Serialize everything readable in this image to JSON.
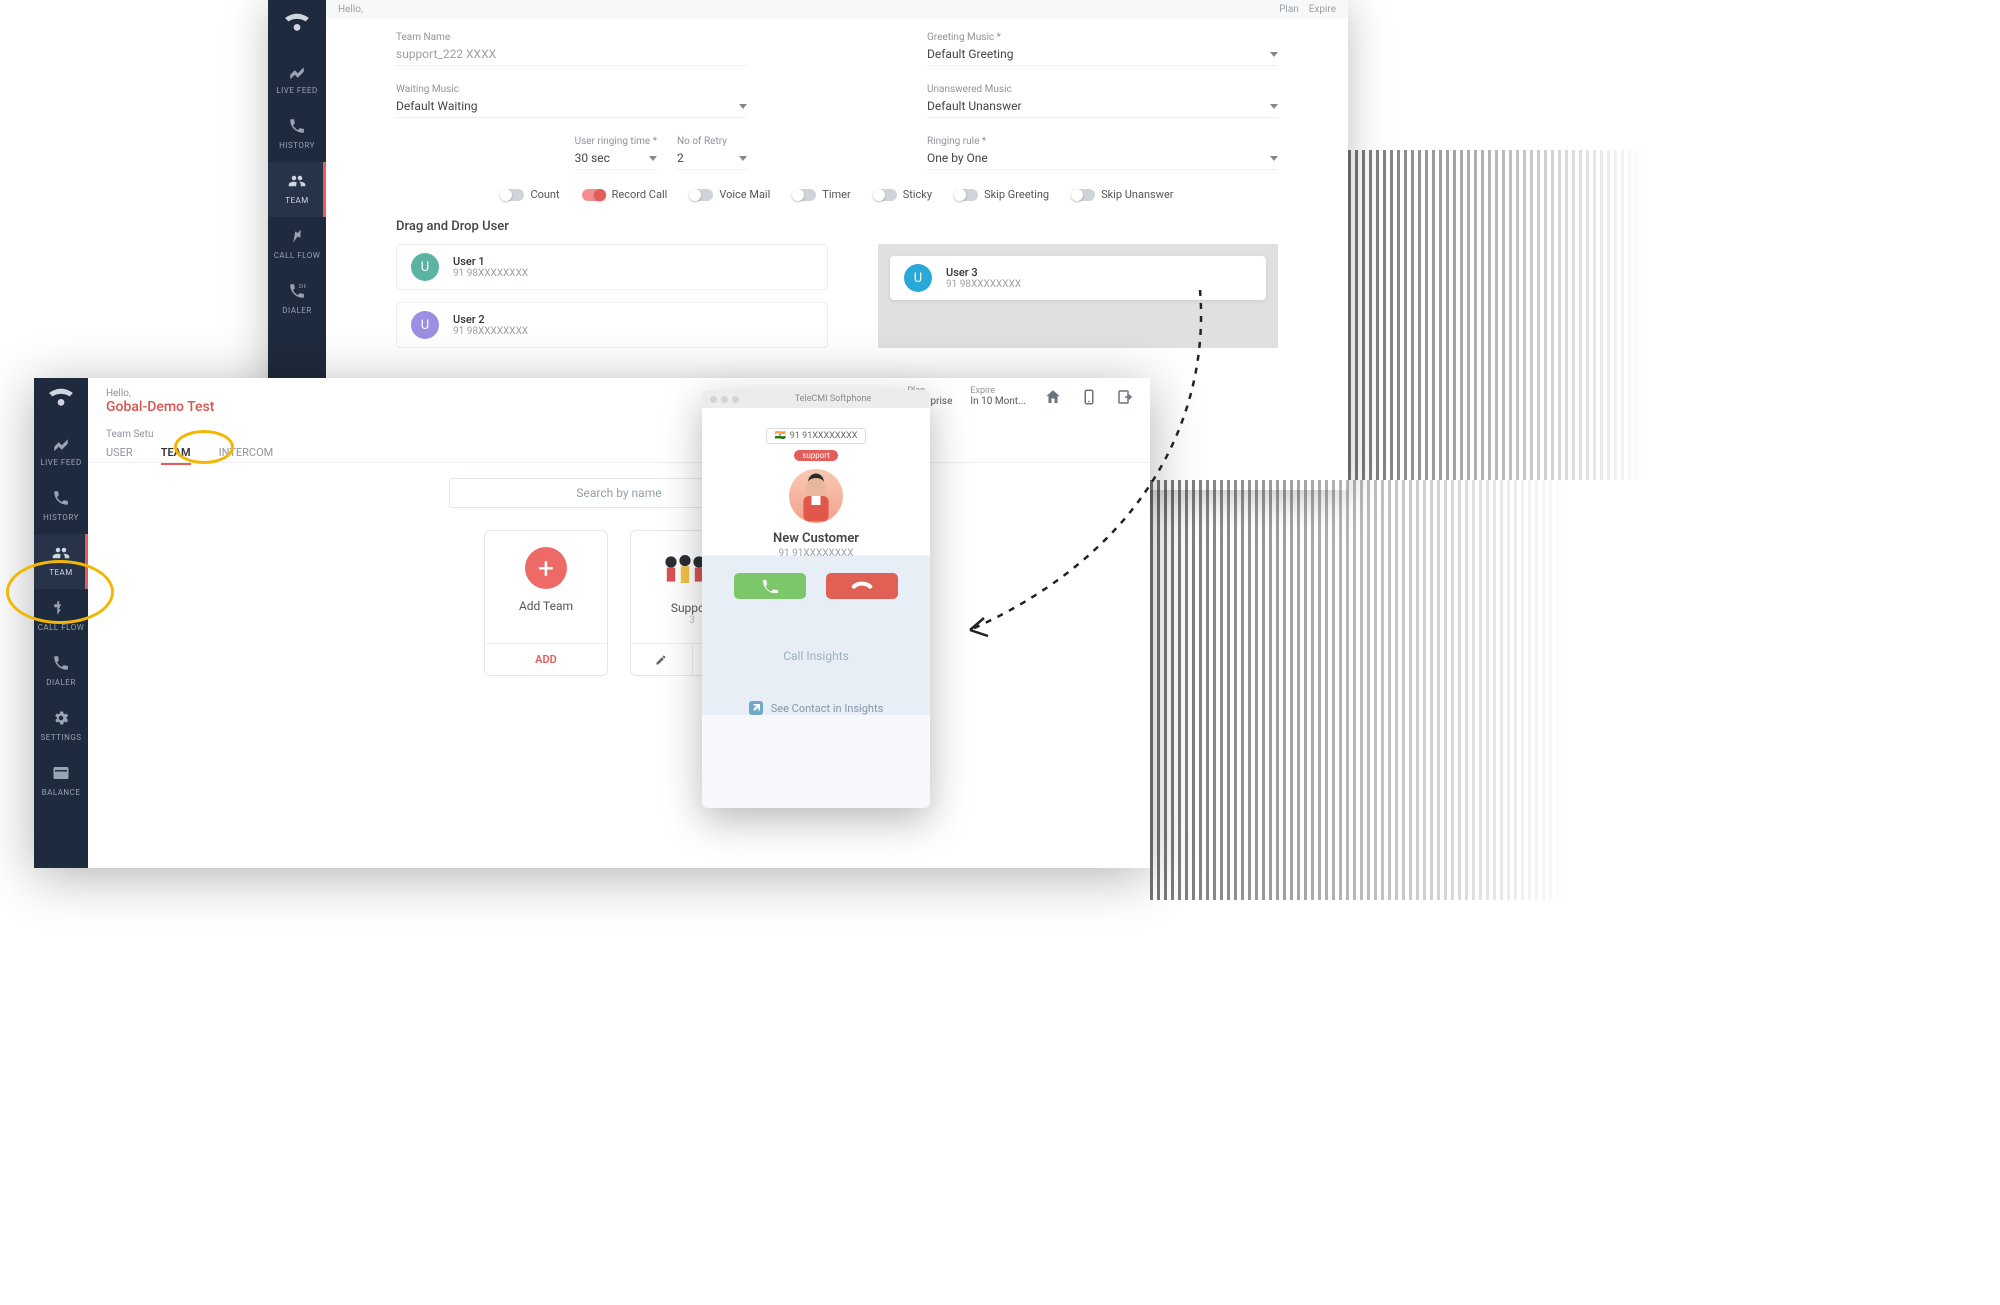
{
  "back": {
    "hello": "Hello,",
    "topbar": {
      "plan_label": "Plan",
      "expire_label": "Expire"
    },
    "sidebar": [
      {
        "label": "LIVE FEED"
      },
      {
        "label": "HISTORY"
      },
      {
        "label": "TEAM"
      },
      {
        "label": "CALL FLOW"
      },
      {
        "label": "DIALER"
      }
    ],
    "fields": {
      "team_name_label": "Team Name",
      "team_name_value": "support_222 XXXX",
      "greeting_label": "Greeting Music *",
      "greeting_value": "Default Greeting",
      "waiting_label": "Waiting Music",
      "waiting_value": "Default Waiting",
      "unanswered_label": "Unanswered Music",
      "unanswered_value": "Default Unanswer",
      "ring_time_label": "User ringing time *",
      "ring_time_value": "30 sec",
      "retry_label": "No of Retry",
      "retry_value": "2",
      "ring_rule_label": "Ringing rule *",
      "ring_rule_value": "One by One"
    },
    "toggles": {
      "count": "Count",
      "record": "Record Call",
      "voicemail": "Voice Mail",
      "timer": "Timer",
      "sticky": "Sticky",
      "skip_greeting": "Skip Greeting",
      "skip_unanswer": "Skip Unanswer"
    },
    "drag_drop_title": "Drag and Drop User",
    "users_left": [
      {
        "name": "User 1",
        "phone": "91 98XXXXXXXX",
        "color": "#5bb3a3"
      },
      {
        "name": "User 2",
        "phone": "91 98XXXXXXXX",
        "color": "#9a8fe0"
      }
    ],
    "users_right": [
      {
        "name": "User 3",
        "phone": "91 98XXXXXXXX",
        "color": "#2aa9d9"
      }
    ]
  },
  "front": {
    "hello": "Hello,",
    "tenant": "Gobal-Demo Test",
    "section_title": "Team Setu",
    "tabs": {
      "user": "USER",
      "team": "TEAM",
      "intercom": "INTERCOM"
    },
    "head_right": {
      "plan_label": "Plan",
      "plan_value": "Enterprise",
      "expire_label": "Expire",
      "expire_value": "In 10 Mont..."
    },
    "sidebar": [
      {
        "label": "LIVE FEED"
      },
      {
        "label": "HISTORY"
      },
      {
        "label": "TEAM"
      },
      {
        "label": "CALL FLOW"
      },
      {
        "label": "DIALER"
      },
      {
        "label": "SETTINGS"
      },
      {
        "label": "BALANCE"
      }
    ],
    "search_placeholder": "Search by name",
    "add_team_title": "Add Team",
    "add_button": "ADD",
    "team_card_title": "Support",
    "team_card_count": "3"
  },
  "softphone": {
    "title": "TeleCMI Softphone",
    "badge_number": "91 91XXXXXXXX",
    "pill_label": "support",
    "caller_name": "New Customer",
    "caller_number": "91 91XXXXXXXX",
    "insights_title": "Call Insights",
    "insights_link": "See Contact in Insights"
  }
}
